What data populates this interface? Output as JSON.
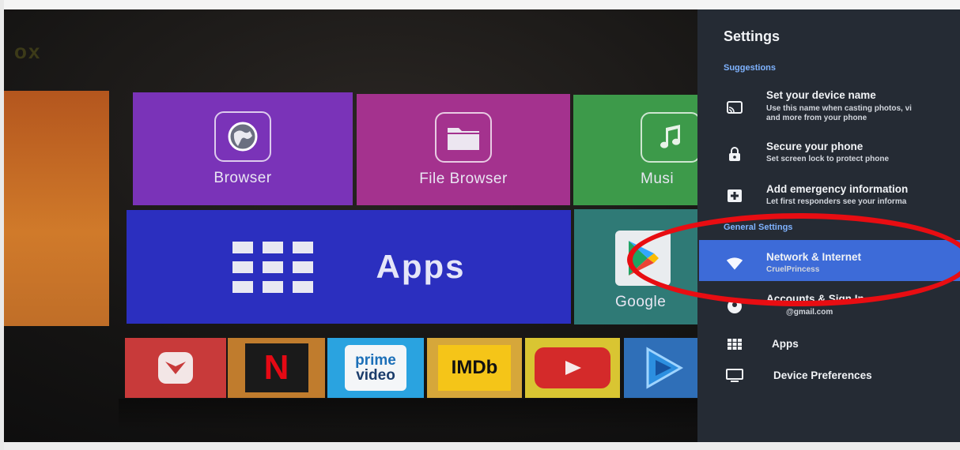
{
  "launcher": {
    "brand_text": "ox",
    "tiles": {
      "browser": "Browser",
      "file_browser": "File Browser",
      "music": "Musi",
      "apps": "Apps",
      "google_play": "Google"
    },
    "app_row": {
      "prime_line1": "prime",
      "prime_line2": "video",
      "imdb": "IMDb",
      "netflix": "N"
    }
  },
  "settings": {
    "title": "Settings",
    "suggestions_header": "Suggestions",
    "general_header": "General Settings",
    "suggestions": [
      {
        "title": "Set your device name",
        "subtitle_line1": "Use this name when casting photos, vi",
        "subtitle_line2": "and more from your phone",
        "icon": "cast-icon"
      },
      {
        "title": "Secure your phone",
        "subtitle_line1": "Set screen lock to protect phone",
        "icon": "lock-icon"
      },
      {
        "title": "Add emergency information",
        "subtitle_line1": "Let first responders see your informa",
        "icon": "medical-plus-icon"
      }
    ],
    "general": [
      {
        "title": "Network & Internet",
        "subtitle": "CruelPrincess",
        "icon": "wifi-icon",
        "selected": true
      },
      {
        "title": "Accounts & Sign In",
        "subtitle": "@gmail.com",
        "icon": "account-icon"
      },
      {
        "title": "Apps",
        "icon": "apps-grid-icon"
      },
      {
        "title": "Device Preferences",
        "icon": "tv-icon"
      }
    ]
  },
  "colors": {
    "panel_bg": "#252b34",
    "selection": "#3d6bd8",
    "section_header": "#7fb3ff",
    "annotation_circle": "#e80d12"
  }
}
